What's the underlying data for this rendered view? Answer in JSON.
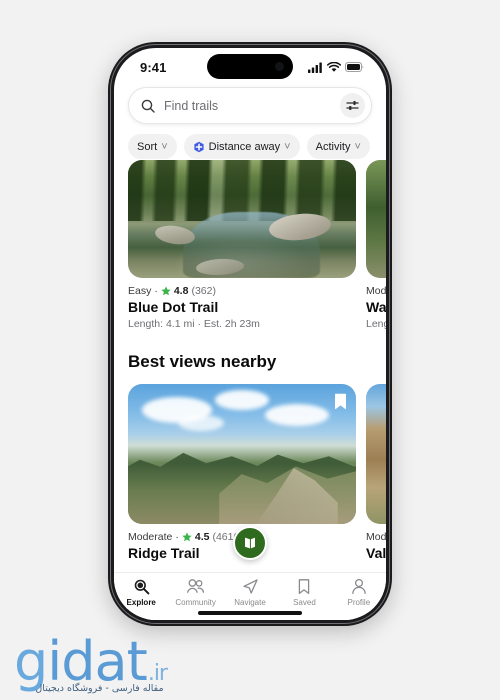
{
  "status_bar": {
    "time": "9:41",
    "cellular_icon": "cellular-bars-icon",
    "wifi_icon": "wifi-icon",
    "battery_icon": "battery-icon"
  },
  "search": {
    "placeholder": "Find trails",
    "value": "",
    "search_icon": "search-icon",
    "filter_icon": "sliders-icon"
  },
  "chips": [
    {
      "label": "Sort",
      "has_icon": false,
      "caret": "˅"
    },
    {
      "label": "Distance away",
      "has_icon": true,
      "icon": "location-pin-icon",
      "icon_color": "#3f5ae0",
      "caret": "˅"
    },
    {
      "label": "Activity",
      "has_icon": false,
      "caret": "˅"
    }
  ],
  "sections": [
    {
      "header": "",
      "cards": [
        {
          "difficulty": "Easy",
          "separator": "·",
          "star_icon": "star-icon",
          "star_color": "#3bb54a",
          "rating": "4.8",
          "reviews": "(362)",
          "title": "Blue Dot Trail",
          "length": "Length: 4.1 mi · Est. 2h 23m",
          "photo": "forest-stream"
        },
        {
          "difficulty": "Mode",
          "separator": "",
          "star_icon": "star-icon",
          "star_color": "#3bb54a",
          "rating": "",
          "reviews": "",
          "title": "Wate",
          "length": "Lengt",
          "photo": "forest-partial"
        }
      ]
    },
    {
      "header": "Best views nearby",
      "cards": [
        {
          "difficulty": "Moderate",
          "separator": "·",
          "star_icon": "star-icon",
          "star_color": "#3bb54a",
          "rating": "4.5",
          "reviews": "(4616)",
          "title": "Ridge Trail",
          "length": "",
          "photo": "mountain-ridge",
          "bookmark_icon": "bookmark-icon"
        },
        {
          "difficulty": "Mode",
          "separator": "",
          "star_icon": "star-icon",
          "star_color": "#3bb54a",
          "rating": "",
          "reviews": "",
          "title": "Valle",
          "length": "",
          "photo": "canyon-partial"
        }
      ]
    }
  ],
  "map_fab": {
    "icon": "map-icon",
    "color": "#2f6b1f"
  },
  "tab_bar": {
    "items": [
      {
        "label": "Explore",
        "icon": "magnifier-icon",
        "active": true
      },
      {
        "label": "Community",
        "icon": "people-icon",
        "active": false
      },
      {
        "label": "Navigate",
        "icon": "paper-plane-icon",
        "active": false
      },
      {
        "label": "Saved",
        "icon": "bookmark-icon",
        "active": false
      },
      {
        "label": "Profile",
        "icon": "person-icon",
        "active": false
      }
    ]
  },
  "watermark": {
    "brand_g": "g",
    "brand_rest": "idat",
    "tld": ".ir",
    "subtitle": "مقاله فارسی - فروشگاه دیجیتال"
  }
}
